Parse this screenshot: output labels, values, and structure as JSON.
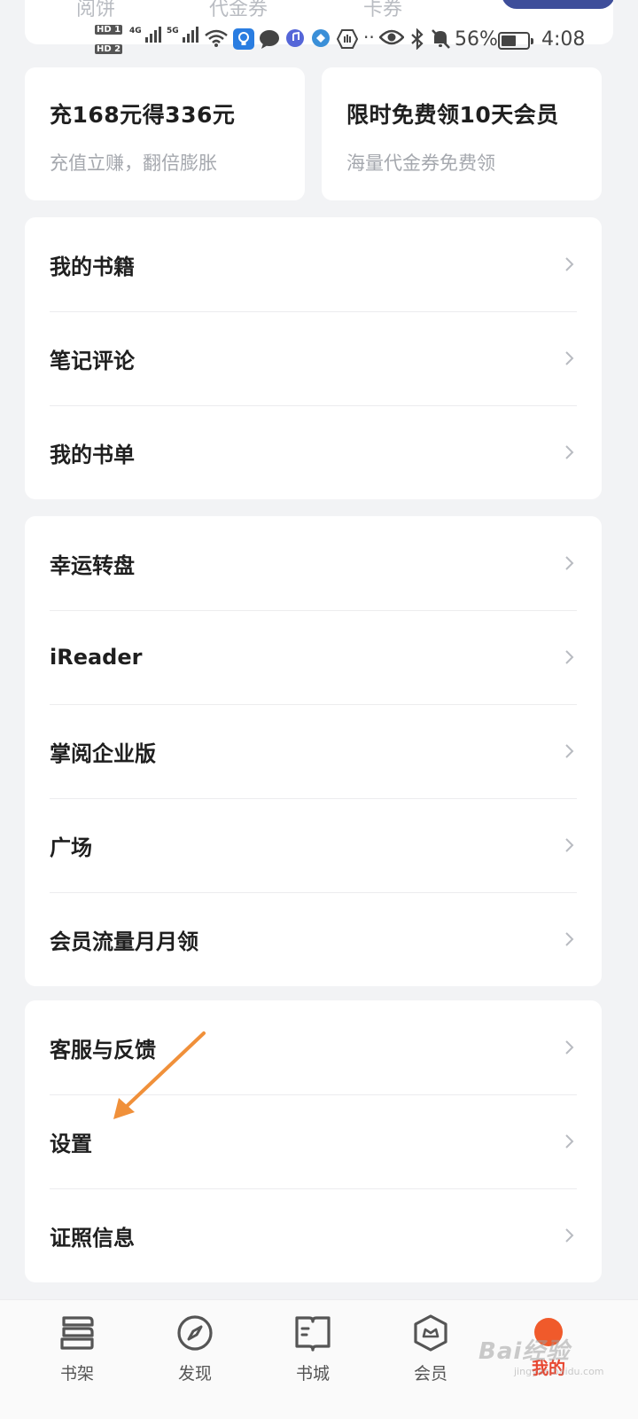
{
  "top_tabs": [
    "阅饼",
    "代金券",
    "卡券"
  ],
  "status_bar": {
    "hd1": "HD 1",
    "hd2": "HD 2",
    "net1": "4G",
    "net2": "5G",
    "battery": "56%",
    "battery_level": 0.56,
    "time": "4:08"
  },
  "promos": [
    {
      "title": "充168元得336元",
      "subtitle": "充值立赚，翻倍膨胀"
    },
    {
      "title": "限时免费领10天会员",
      "subtitle": "海量代金券免费领"
    }
  ],
  "menu_group_1": [
    "我的书籍",
    "笔记评论",
    "我的书单"
  ],
  "menu_group_2": [
    "幸运转盘",
    "iReader",
    "掌阅企业版",
    "广场",
    "会员流量月月领"
  ],
  "menu_group_3": [
    "客服与反馈",
    "设置",
    "证照信息"
  ],
  "bottom_nav": [
    {
      "label": "书架",
      "icon": "bookshelf-icon"
    },
    {
      "label": "发现",
      "icon": "compass-icon"
    },
    {
      "label": "书城",
      "icon": "book-store-icon"
    },
    {
      "label": "会员",
      "icon": "member-icon"
    },
    {
      "label": "我的",
      "icon": "profile-icon",
      "active": true
    }
  ],
  "colors": {
    "accent": "#e8452f",
    "background": "#f2f3f5",
    "card": "#ffffff",
    "annotation_arrow": "#f0903a"
  },
  "watermark": {
    "brand": "Bai经验",
    "url": "jingyan.baidu.com"
  }
}
